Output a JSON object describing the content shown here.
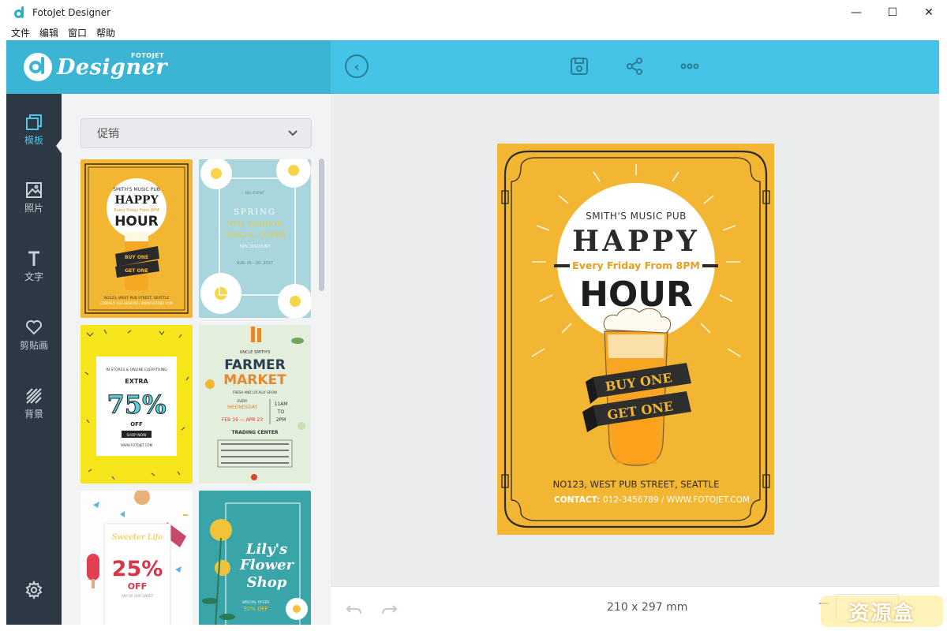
{
  "window": {
    "title": "FotoJet Designer",
    "minimize": "—",
    "maximize": "☐",
    "close": "✕"
  },
  "menu": [
    "文件",
    "编辑",
    "窗口",
    "帮助"
  ],
  "header": {
    "logo_word": "Designer",
    "logo_sup": "FOTOJET"
  },
  "nav": [
    {
      "label": "模板",
      "icon": "template-icon",
      "active": true
    },
    {
      "label": "照片",
      "icon": "photo-icon",
      "active": false
    },
    {
      "label": "文字",
      "icon": "text-icon",
      "active": false
    },
    {
      "label": "剪贴画",
      "icon": "heart-icon",
      "active": false
    },
    {
      "label": "背景",
      "icon": "background-icon",
      "active": false
    }
  ],
  "panel": {
    "category": "促销"
  },
  "thumbnails": [
    {
      "name": "happy-hour",
      "texts": [
        "SMITH'S MUSIC PUB",
        "HAPPY",
        "Every Friday From 8PM",
        "HOUR",
        "BUY ONE",
        "GET ONE",
        "NO123, WEST PUB STREET, SEATTLE",
        "CONTACT: 012-3456789 / WWW.FOTOJET.COM"
      ]
    },
    {
      "name": "spring-fashion",
      "texts": [
        "BIG EVENT",
        "SPRING",
        "NEW FASHION",
        "SPECIAL OFFER",
        "50% DISCOUNT",
        "AUG 15 - 20, 2017"
      ]
    },
    {
      "name": "extra-75",
      "texts": [
        "IN STORES & ONLINE EVERYTHING",
        "EXTRA",
        "75%",
        "OFF",
        "SHOP NOW",
        "WWW.FOTOJET.COM"
      ]
    },
    {
      "name": "farmer-market",
      "texts": [
        "UNCLE SMITH'S",
        "FARMER",
        "MARKET",
        "FRESH AND LOCALLY GROW",
        "EVERY",
        "WEDNESDAY",
        "FEB 19 — APR 23",
        "11AM",
        "TO",
        "2PM",
        "TRADING CENTER"
      ]
    },
    {
      "name": "sweeter-life",
      "texts": [
        "Sweeter Life",
        "25%",
        "OFF",
        "ANY OF OUR SWEET"
      ]
    },
    {
      "name": "lilys-flower",
      "texts": [
        "Lily's",
        "Flower",
        "Shop",
        "SPECIAL OFFER",
        "50% OFF"
      ]
    }
  ],
  "poster": {
    "pub": "SMITH'S MUSIC PUB",
    "happy": "HAPPY",
    "every": "Every Friday From 8PM",
    "hour": "HOUR",
    "buy": "BUY ONE",
    "get": "GET ONE",
    "address": "NO123, WEST PUB STREET, SEATTLE",
    "contact_label": "CONTACT:",
    "contact": "012-3456789 / WWW.FOTOJET.COM"
  },
  "bottom": {
    "size": "210 x 297 mm",
    "zoom_minus": "—"
  },
  "watermark": "资源盒",
  "colors": {
    "accent": "#45c3e6",
    "nav_bg": "#2c3844",
    "poster_bg": "#f2b632",
    "nav_active": "#4fc3e8"
  }
}
